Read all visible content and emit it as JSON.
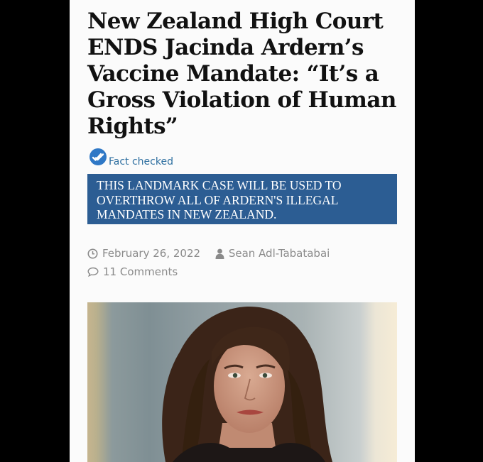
{
  "article": {
    "headline": "New Zealand High Court ENDS Jacinda Ardern’s Vaccine Mandate: “It’s a Gross Violation of Human Rights”",
    "fact_checked_label": "Fact checked",
    "banner_text": "THIS LANDMARK CASE WILL BE USED TO OVERTHROW ALL OF ARDERN'S ILLEGAL MANDATES IN NEW ZEALAND.",
    "date": "February 26, 2022",
    "author": "Sean Adl-Tabatabai",
    "comments": "11 Comments"
  },
  "icons": {
    "fact_check": "checkmark-badge-icon",
    "date": "clock-icon",
    "author": "user-icon",
    "comments": "speech-bubble-icon"
  },
  "colors": {
    "banner_bg": "#2c5d93",
    "fact_check_blue": "#2e6fa0",
    "meta_gray": "#8a8a8a",
    "headline": "#111111"
  }
}
